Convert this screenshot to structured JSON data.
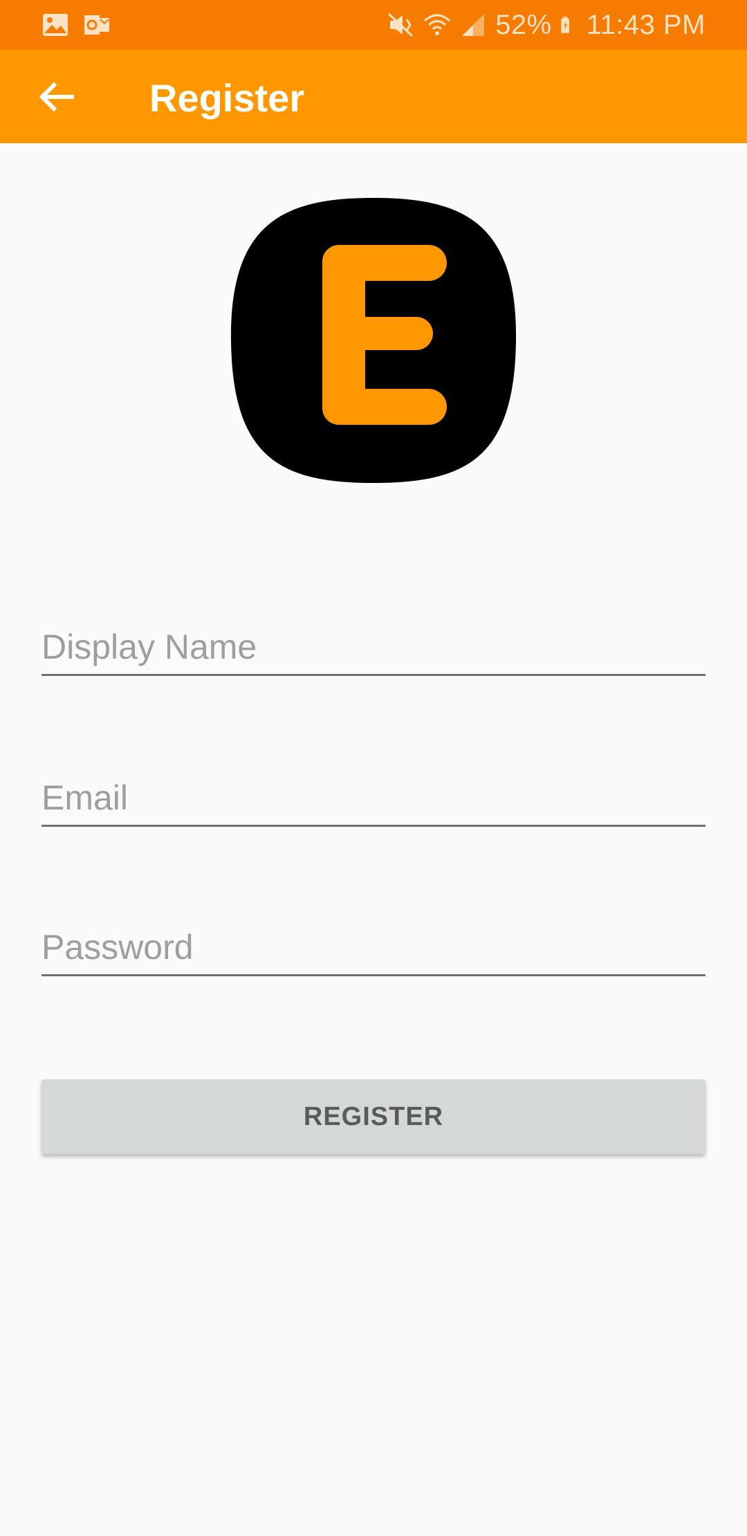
{
  "status_bar": {
    "battery": "52%",
    "time": "11:43 PM",
    "left_icons": [
      "gallery-icon",
      "outlook-icon"
    ],
    "right_icons": [
      "mute-icon",
      "wifi-icon",
      "signal-icon",
      "battery-icon"
    ]
  },
  "app_bar": {
    "title": "Register",
    "back_icon": "arrow-back-icon",
    "color": "#ff9800"
  },
  "logo": {
    "letter": "E",
    "background": "#000000",
    "color": "#ff9800"
  },
  "form": {
    "display_name_placeholder": "Display Name",
    "display_name_value": "",
    "email_placeholder": "Email",
    "email_value": "",
    "password_placeholder": "Password",
    "password_value": ""
  },
  "register_button_label": "REGISTER"
}
